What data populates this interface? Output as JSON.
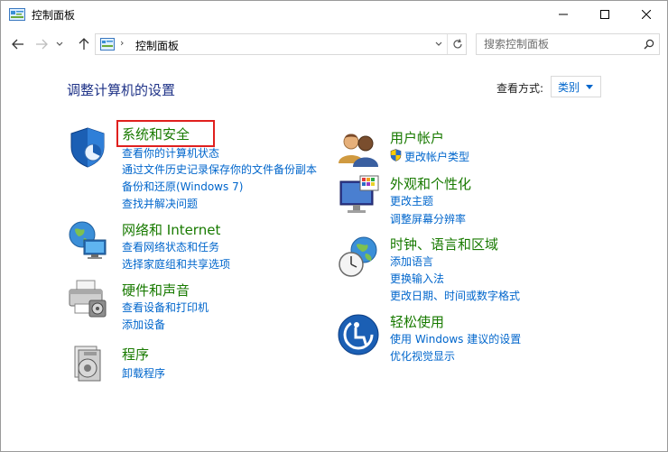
{
  "window": {
    "title": "控制面板",
    "minimize_glyph": "─",
    "maximize_glyph": "☐",
    "close_glyph": "✕"
  },
  "nav": {
    "address_text": "控制面板",
    "address_separator": "›",
    "search_placeholder": "搜索控制面板"
  },
  "main": {
    "heading": "调整计算机的设置",
    "view_by_label": "查看方式:",
    "view_by_value": "类别"
  },
  "categories": {
    "system_security": {
      "title": "系统和安全",
      "links": [
        "查看你的计算机状态",
        "通过文件历史记录保存你的文件备份副本",
        "备份和还原(Windows 7)",
        "查找并解决问题"
      ]
    },
    "network": {
      "title": "网络和 Internet",
      "links": [
        "查看网络状态和任务",
        "选择家庭组和共享选项"
      ]
    },
    "hardware": {
      "title": "硬件和声音",
      "links": [
        "查看设备和打印机",
        "添加设备"
      ]
    },
    "programs": {
      "title": "程序",
      "links": [
        "卸载程序"
      ]
    },
    "user_accounts": {
      "title": "用户帐户",
      "links": [
        "更改帐户类型"
      ]
    },
    "appearance": {
      "title": "外观和个性化",
      "links": [
        "更改主题",
        "调整屏幕分辨率"
      ]
    },
    "clock_region": {
      "title": "时钟、语言和区域",
      "links": [
        "添加语言",
        "更换输入法",
        "更改日期、时间或数字格式"
      ]
    },
    "ease_access": {
      "title": "轻松使用",
      "links": [
        "使用 Windows 建议的设置",
        "优化视觉显示"
      ]
    }
  },
  "colors": {
    "category_title": "#187a00",
    "link": "#0066cc",
    "heading": "#1e3287",
    "highlight": "#e0201e"
  }
}
